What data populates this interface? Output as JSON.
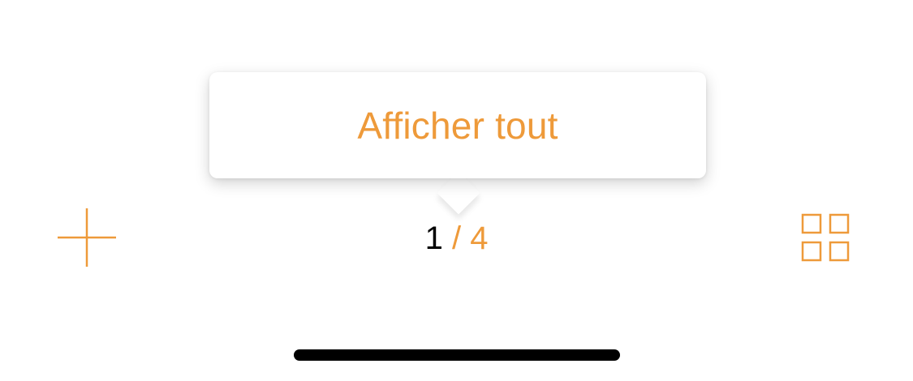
{
  "tooltip": {
    "label": "Afficher tout"
  },
  "toolbar": {
    "add_icon": "plus-icon",
    "grid_icon": "grid-icon",
    "accent_color": "#ee9a3a"
  },
  "pager": {
    "current": "1",
    "separator": "/",
    "total": "4"
  }
}
